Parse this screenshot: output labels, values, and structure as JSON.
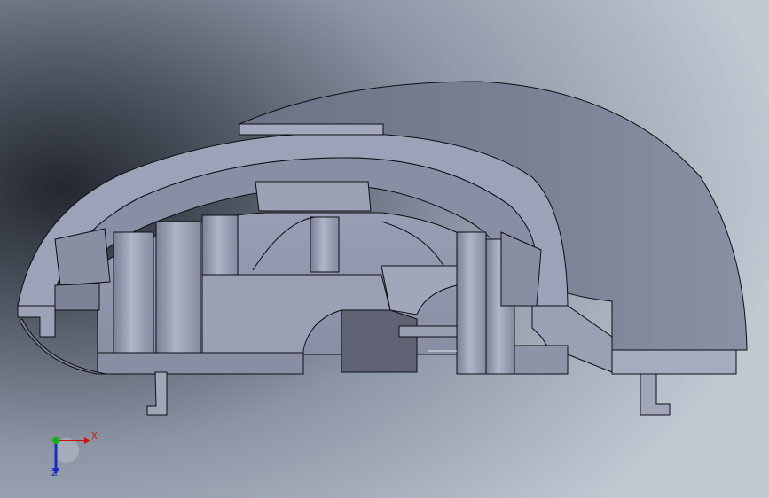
{
  "window": {
    "background_top": "#8f99a8",
    "background_left_shadow": "#2c3038",
    "background_bottom": "#c6ccd6"
  },
  "model": {
    "face_color": "#8e92a6",
    "face_light": "#a6aac0",
    "face_dark": "#6f7488",
    "edge_color": "#0d0d12"
  },
  "triad": {
    "x_label": "X",
    "z_label": "Z",
    "x_color": "#d01010",
    "y_color": "#12b012",
    "z_color": "#1a2cc0"
  }
}
